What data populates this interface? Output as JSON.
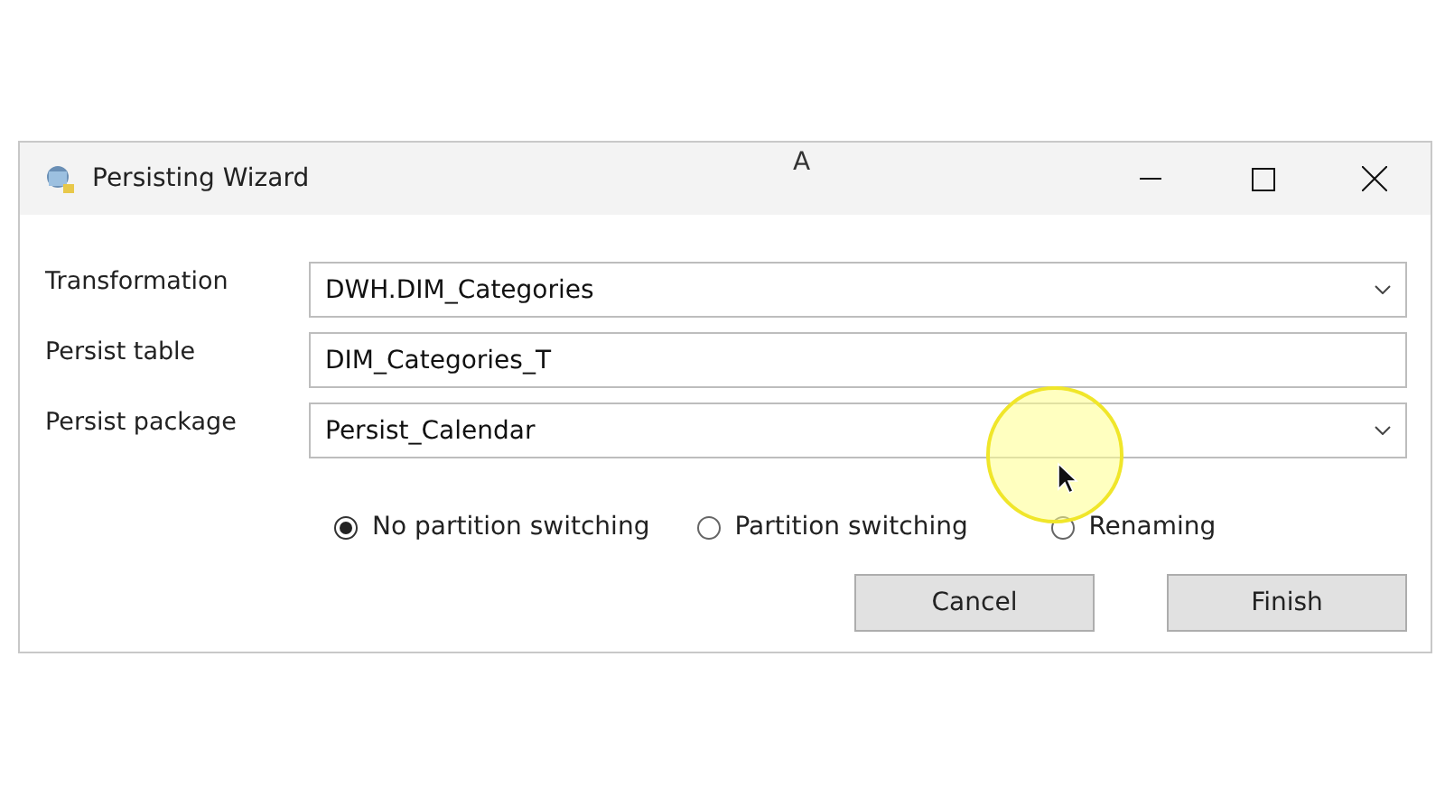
{
  "window": {
    "title": "Persisting Wizard"
  },
  "overlay_text": "A",
  "fields": [
    {
      "kind": "dropdown",
      "label": "Transformation",
      "value": "DWH.DIM_Categories"
    },
    {
      "kind": "text",
      "label": "Persist table",
      "value": "DIM_Categories_T"
    },
    {
      "kind": "dropdown",
      "label": "Persist package",
      "value": "Persist_Calendar"
    }
  ],
  "options": [
    {
      "label": "No partition switching",
      "selected": true
    },
    {
      "label": "Partition switching",
      "selected": false
    },
    {
      "label": "Renaming",
      "selected": false
    }
  ],
  "buttons": [
    "Cancel",
    "Finish"
  ]
}
